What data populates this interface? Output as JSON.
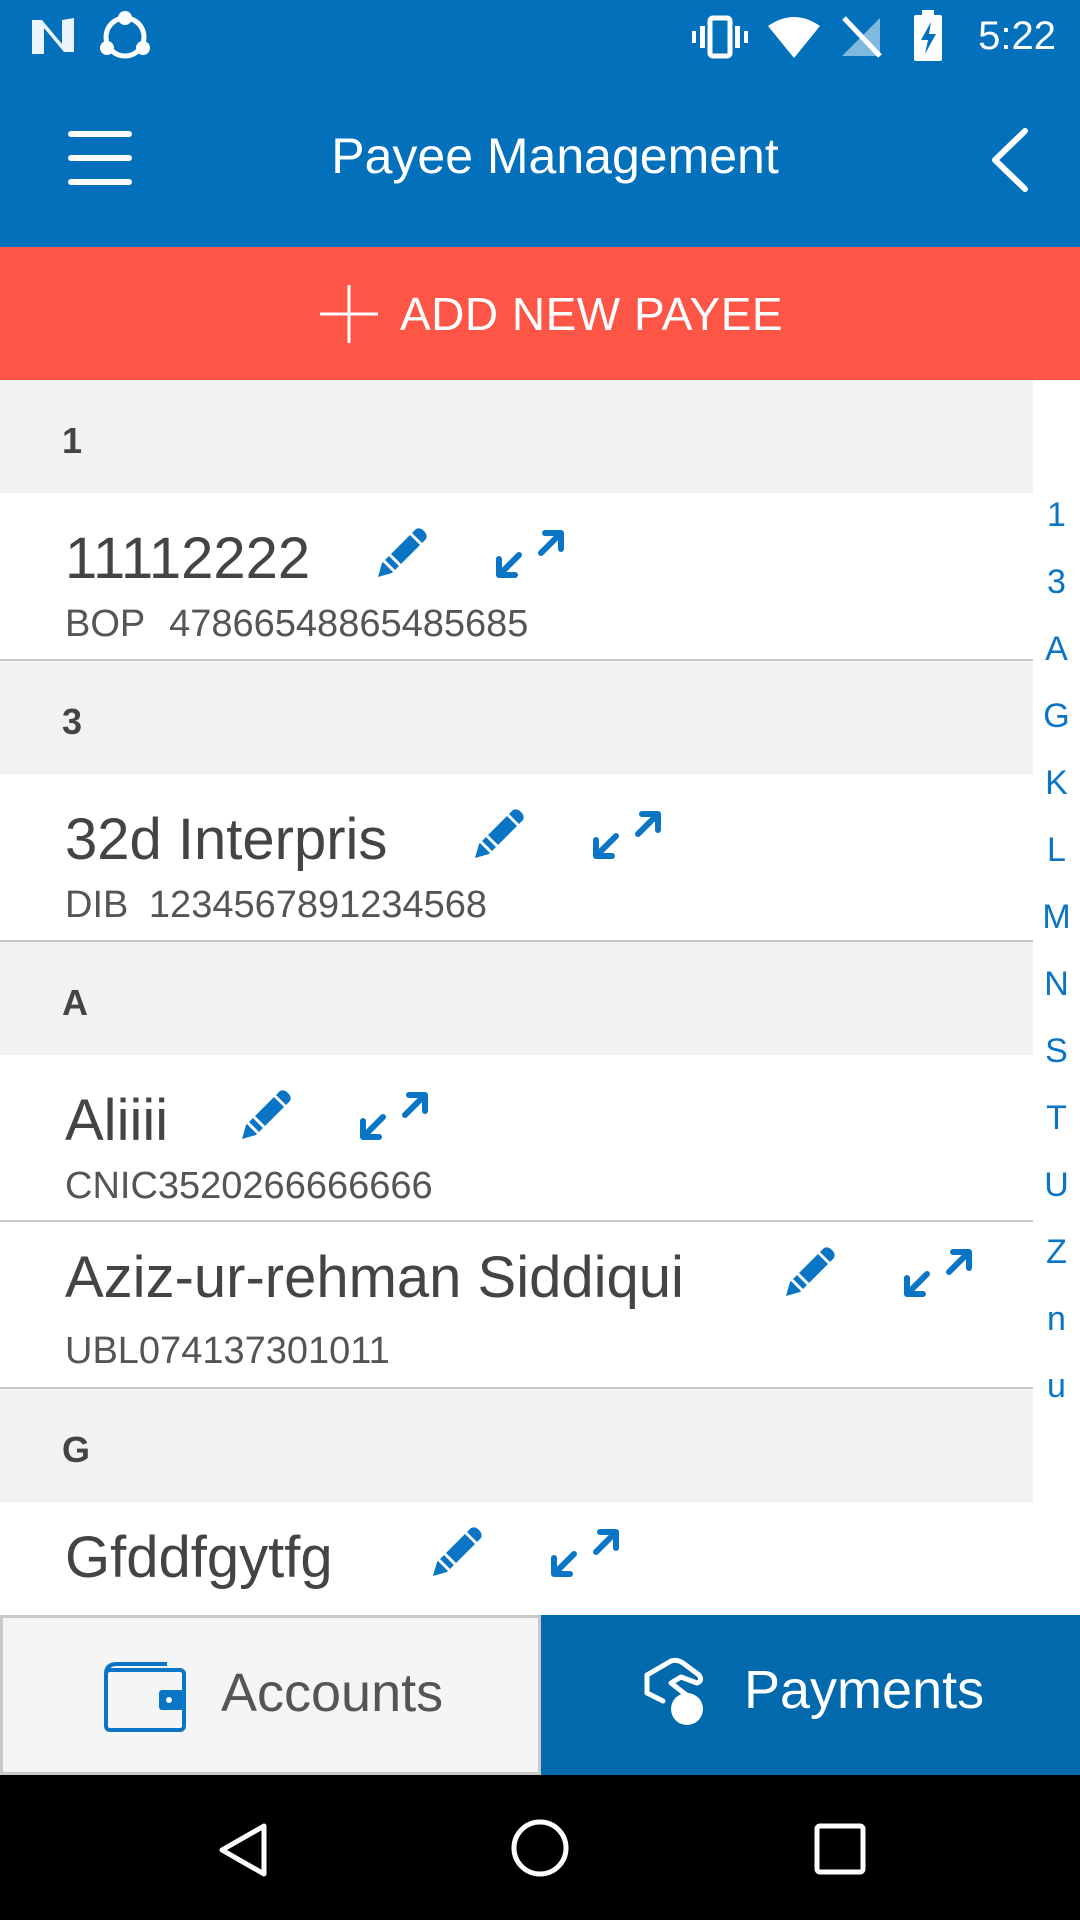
{
  "status_bar": {
    "time": "5:22",
    "icons": [
      "n-notification-icon",
      "share-app-icon",
      "vibrate-icon",
      "wifi-icon",
      "no-signal-icon",
      "battery-charging-icon"
    ]
  },
  "header": {
    "title": "Payee Management",
    "menu_icon": "hamburger-menu-icon",
    "back_icon": "chevron-left-icon"
  },
  "add_payee": {
    "label": "ADD NEW PAYEE",
    "icon": "plus-icon"
  },
  "sections": [
    {
      "letter": "1",
      "payees": [
        {
          "name": "11112222",
          "bank": "BOP",
          "account": "47866548865485685"
        }
      ]
    },
    {
      "letter": "3",
      "payees": [
        {
          "name": "32d Interpris",
          "bank": "DIB",
          "account": "1234567891234568"
        }
      ]
    },
    {
      "letter": "A",
      "payees": [
        {
          "name": "Aliiii",
          "bank": "CNIC",
          "account": "3520266666666"
        },
        {
          "name": "Aziz-ur-rehman Siddiqui",
          "bank": "UBL",
          "account": "074137301011"
        }
      ]
    },
    {
      "letter": "G",
      "payees": [
        {
          "name": "Gfddfgytfg"
        }
      ]
    }
  ],
  "index_letters": [
    "1",
    "3",
    "A",
    "G",
    "K",
    "L",
    "M",
    "N",
    "S",
    "T",
    "U",
    "Z",
    "n",
    "u"
  ],
  "tabs": {
    "accounts": {
      "label": "Accounts",
      "icon": "wallet-icon"
    },
    "payments": {
      "label": "Payments",
      "icon": "hand-coin-icon"
    }
  },
  "nav_bar": {
    "icons": [
      "back-triangle-icon",
      "home-circle-icon",
      "recents-square-icon"
    ]
  },
  "colors": {
    "primary": "#0270bb",
    "accent": "#fd5546",
    "icon_blue": "#0a74c5",
    "section_bg": "#f2f2f2"
  }
}
